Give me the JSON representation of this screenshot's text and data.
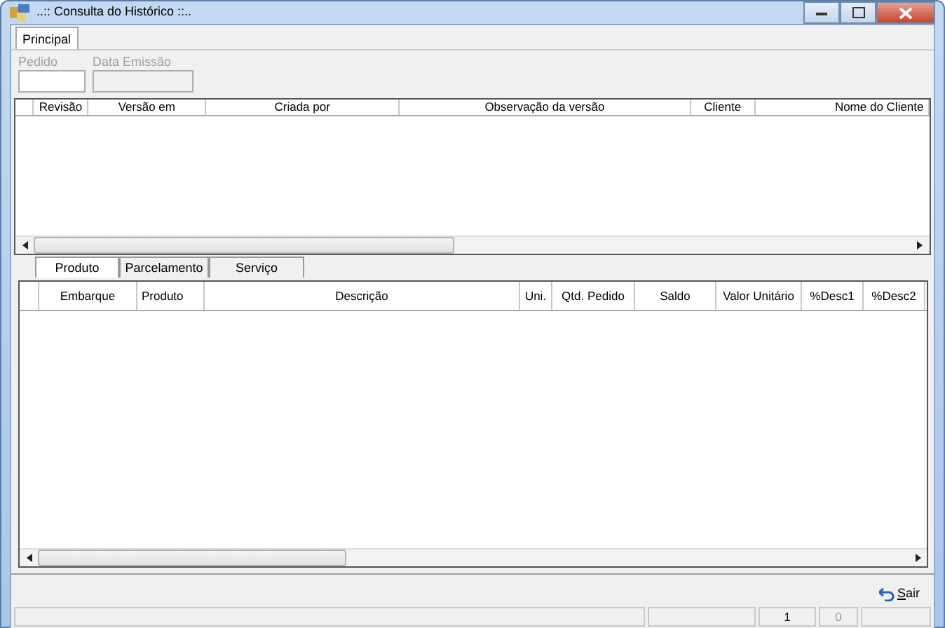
{
  "window": {
    "title": "..:: Consulta do Histórico ::.."
  },
  "tabs": [
    {
      "label": "Principal",
      "selected": true
    }
  ],
  "fields": [
    {
      "label": "Pedido",
      "disabled": false
    },
    {
      "label": "Data Emissão",
      "disabled": true
    }
  ],
  "history_table": {
    "columns": [
      "Revisão",
      "Versão em",
      "Criada por",
      "Observação da versão",
      "Cliente",
      "Nome do Cliente"
    ]
  },
  "detail_tabs": [
    {
      "label": "Produto",
      "selected": true
    },
    {
      "label": "Parcelamento",
      "selected": false
    },
    {
      "label": "Serviço",
      "selected": false
    }
  ],
  "items_table": {
    "columns": [
      "Embarque",
      "Produto",
      "Descrição",
      "Uni.",
      "Qtd. Pedido",
      "Saldo",
      "Valor Unitário",
      "%Desc1",
      "%Desc2"
    ]
  },
  "buttons": [
    {
      "label": "Sair"
    }
  ],
  "status_bar": [
    {
      "text": "1",
      "disabled": false
    },
    {
      "text": "0",
      "disabled": true
    }
  ]
}
